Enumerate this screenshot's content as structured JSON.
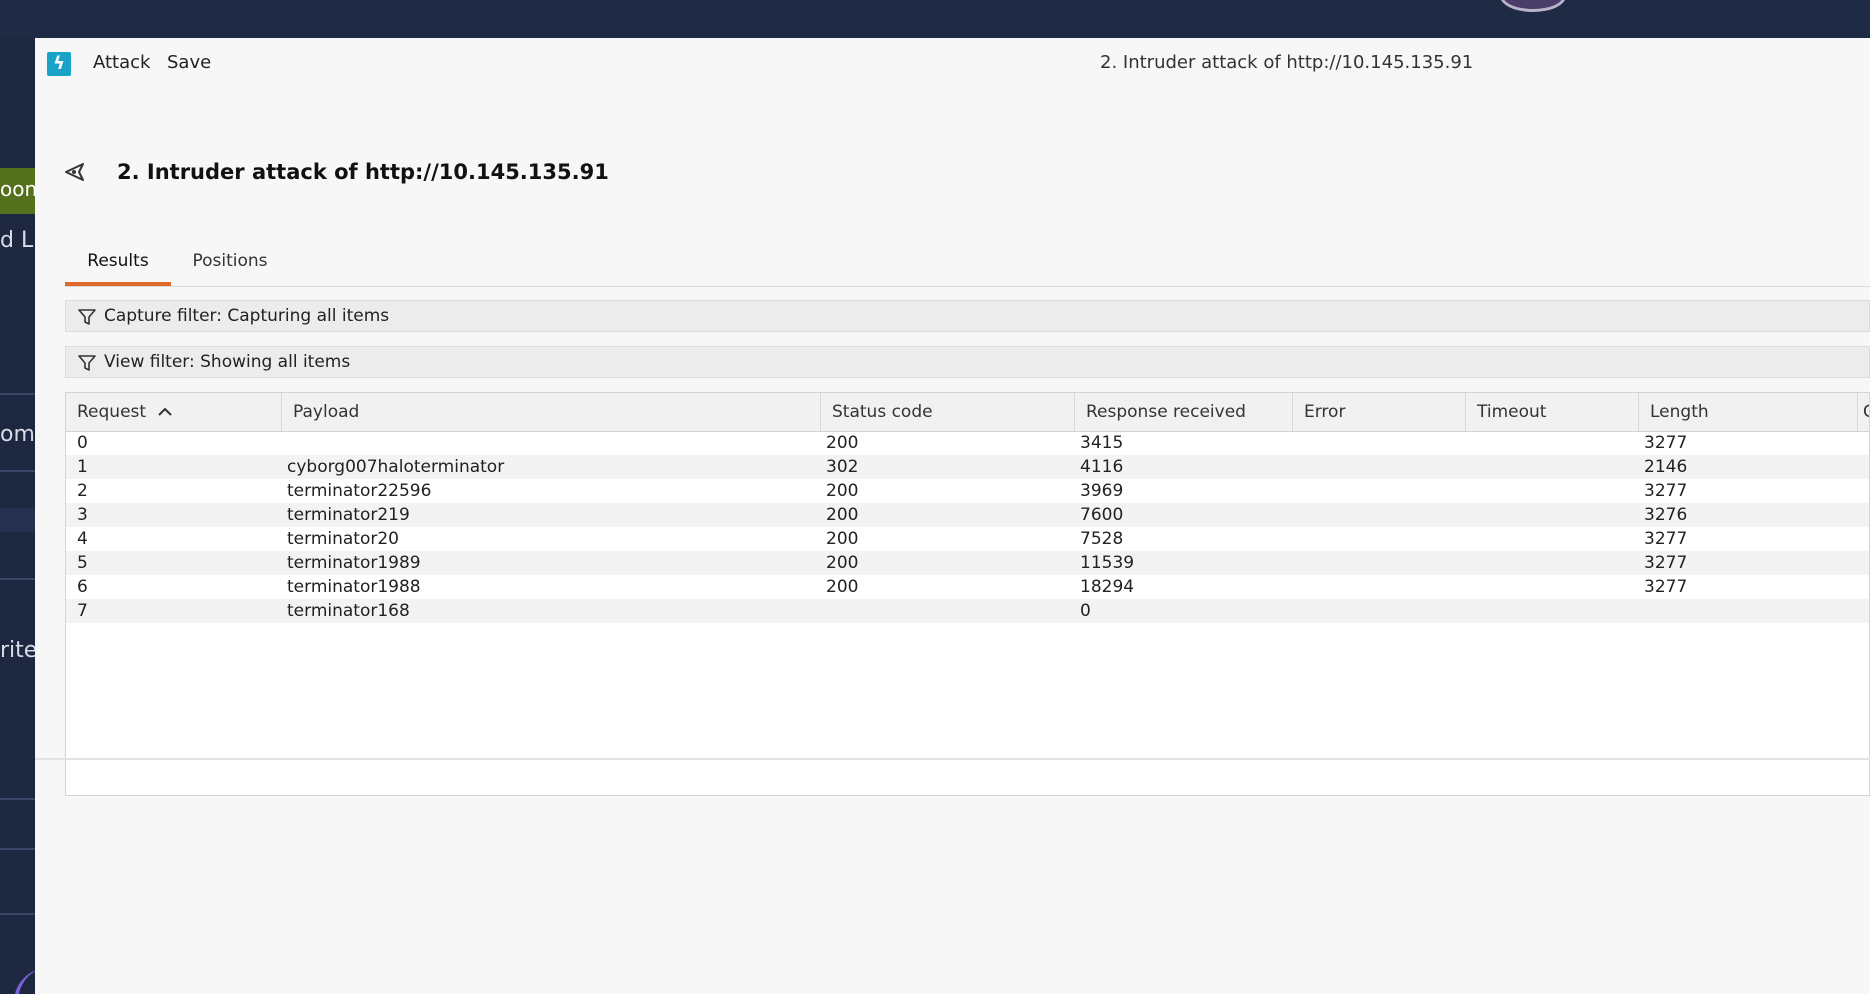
{
  "background": {
    "left_fragments": [
      "oon",
      "d Li",
      "om",
      "rite"
    ]
  },
  "window": {
    "menu": {
      "attack": "Attack",
      "save": "Save"
    },
    "title": "2. Intruder attack of http://10.145.135.91"
  },
  "page": {
    "title": "2. Intruder attack of http://10.145.135.91",
    "tabs": [
      {
        "label": "Results",
        "active": true
      },
      {
        "label": "Positions",
        "active": false
      }
    ],
    "capture_filter": "Capture filter: Capturing all items",
    "view_filter": "View filter: Showing all items"
  },
  "table": {
    "columns": [
      "Request",
      "Payload",
      "Status code",
      "Response received",
      "Error",
      "Timeout",
      "Length",
      "C"
    ],
    "sort_indicator": "^",
    "rows": [
      {
        "request": "0",
        "payload": "",
        "status": "200",
        "response": "3415",
        "error": "",
        "timeout": "",
        "length": "3277"
      },
      {
        "request": "1",
        "payload": "cyborg007haloterminator",
        "status": "302",
        "response": "4116",
        "error": "",
        "timeout": "",
        "length": "2146"
      },
      {
        "request": "2",
        "payload": "terminator22596",
        "status": "200",
        "response": "3969",
        "error": "",
        "timeout": "",
        "length": "3277"
      },
      {
        "request": "3",
        "payload": "terminator219",
        "status": "200",
        "response": "7600",
        "error": "",
        "timeout": "",
        "length": "3276"
      },
      {
        "request": "4",
        "payload": "terminator20",
        "status": "200",
        "response": "7528",
        "error": "",
        "timeout": "",
        "length": "3277"
      },
      {
        "request": "5",
        "payload": "terminator1989",
        "status": "200",
        "response": "11539",
        "error": "",
        "timeout": "",
        "length": "3277"
      },
      {
        "request": "6",
        "payload": "terminator1988",
        "status": "200",
        "response": "18294",
        "error": "",
        "timeout": "",
        "length": "3277"
      },
      {
        "request": "7",
        "payload": "terminator168",
        "status": "",
        "response": "0",
        "error": "",
        "timeout": "",
        "length": ""
      }
    ]
  },
  "colors": {
    "accent_tab": "#e06a2c",
    "app_icon": "#1aa3c8",
    "window_bg": "#f7f7f7",
    "desktop_bg": "#1b2338"
  }
}
